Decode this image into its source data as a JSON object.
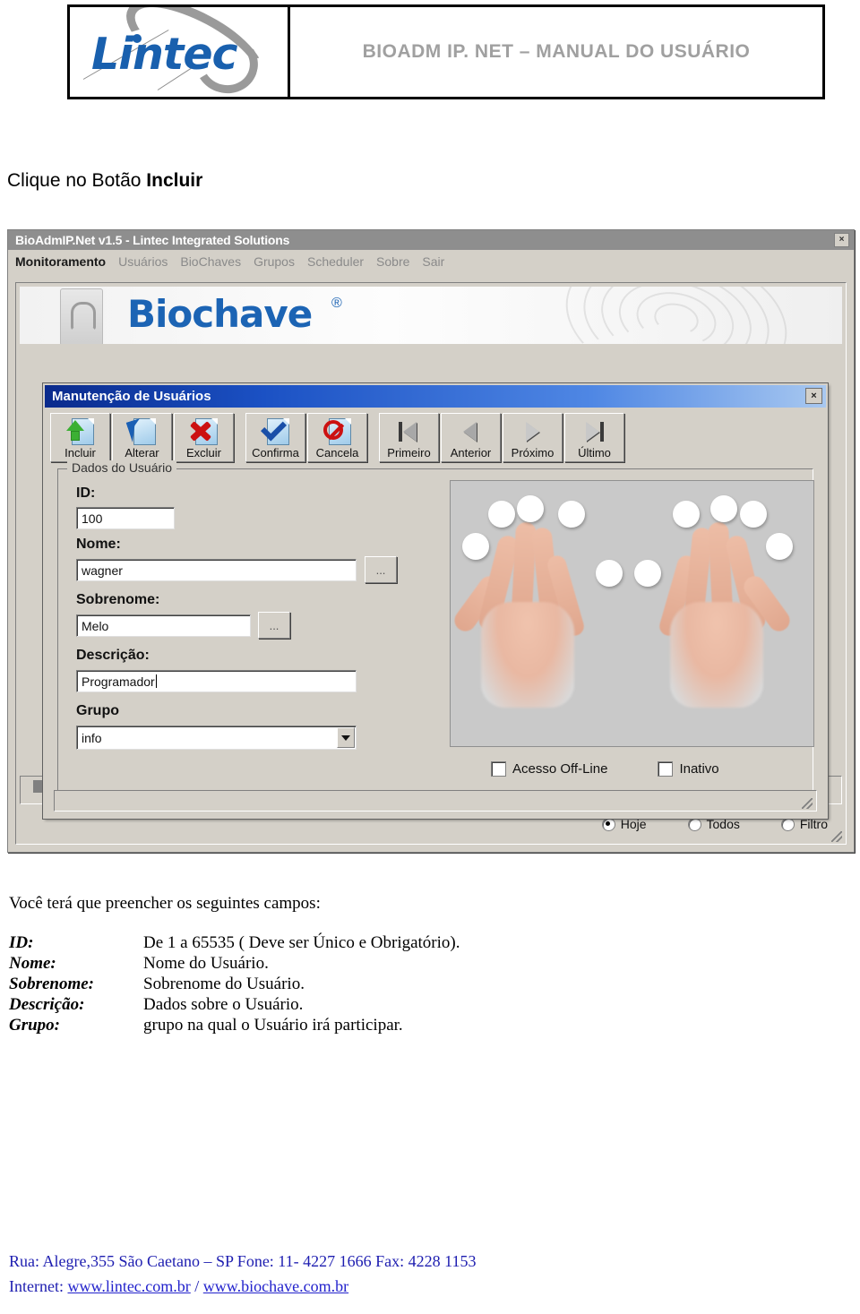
{
  "doc_header": {
    "logo_text": "Lintec",
    "title": "BIOADM IP. NET – MANUAL DO USUÁRIO"
  },
  "instruction": {
    "prefix": "Clique no Botão ",
    "bold": "Incluir"
  },
  "app_window": {
    "title": "BioAdmIP.Net v1.5 - Lintec Integrated Solutions",
    "close_label": "×",
    "menu": [
      {
        "label": "Monitoramento",
        "active": true
      },
      {
        "label": "Usuários",
        "active": false
      },
      {
        "label": "BioChaves",
        "active": false
      },
      {
        "label": "Grupos",
        "active": false
      },
      {
        "label": "Scheduler",
        "active": false
      },
      {
        "label": "Sobre",
        "active": false
      },
      {
        "label": "Sair",
        "active": false
      }
    ],
    "banner": {
      "brand": "Biochave",
      "registered": "®"
    },
    "filter_radios": [
      {
        "label": "Hoje",
        "selected": true
      },
      {
        "label": "Todos",
        "selected": false
      },
      {
        "label": "Filtro",
        "selected": false
      }
    ]
  },
  "dialog": {
    "title": "Manutenção de Usuários",
    "close_label": "×",
    "toolbar": [
      {
        "label": "Incluir",
        "icon": "upload-document-icon"
      },
      {
        "label": "Alterar",
        "icon": "edit-document-icon"
      },
      {
        "label": "Excluir",
        "icon": "delete-document-icon"
      },
      {
        "label": "Confirma",
        "icon": "check-document-icon"
      },
      {
        "label": "Cancela",
        "icon": "cancel-document-icon"
      },
      {
        "label": "Primeiro",
        "icon": "first-record-icon"
      },
      {
        "label": "Anterior",
        "icon": "previous-record-icon"
      },
      {
        "label": "Próximo",
        "icon": "next-record-icon"
      },
      {
        "label": "Último",
        "icon": "last-record-icon"
      }
    ],
    "groupbox_legend": "Dados do Usuário",
    "fields": {
      "id": {
        "label": "ID:",
        "value": "100"
      },
      "nome": {
        "label": "Nome:",
        "value": "wagner",
        "browse_label": "..."
      },
      "sobrenome": {
        "label": "Sobrenome:",
        "value": "Melo",
        "browse_label": "..."
      },
      "descricao": {
        "label": "Descrição:",
        "value": "Programador"
      },
      "grupo": {
        "label": "Grupo",
        "value": "info"
      }
    },
    "checkboxes": [
      {
        "label": "Acesso Off-Line",
        "checked": false
      },
      {
        "label": "Inativo",
        "checked": false
      }
    ]
  },
  "body": {
    "lead": "Você terá que preencher os seguintes campos:",
    "definitions": [
      {
        "term": "ID:",
        "desc": "De 1 a 65535 ( Deve ser Único e Obrigatório)."
      },
      {
        "term": "Nome:",
        "desc": "Nome do Usuário."
      },
      {
        "term": "Sobrenome:",
        "desc": "Sobrenome do Usuário."
      },
      {
        "term": "Descrição:",
        "desc": "Dados sobre o Usuário."
      },
      {
        "term": "Grupo:",
        "desc": "grupo na qual o Usuário irá participar."
      }
    ]
  },
  "footer": {
    "address_line": "Rua: Alegre,355  São Caetano – SP  Fone: 11- 4227 1666  Fax: 4228 1153",
    "internet_label": "Internet: ",
    "link1": "www.lintec.com.br",
    "separator": " / ",
    "link2": "www.biochave.com.br"
  }
}
